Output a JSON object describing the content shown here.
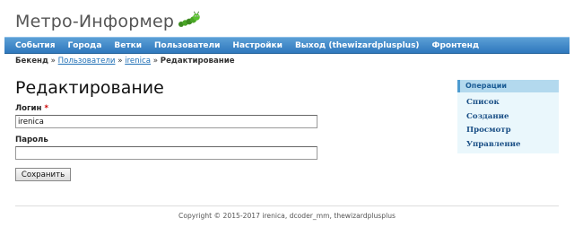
{
  "header": {
    "title": "Метро-Информер",
    "logo_icon": "caterpillar-icon"
  },
  "main_menu": {
    "items": [
      {
        "label": "События"
      },
      {
        "label": "Города"
      },
      {
        "label": "Ветки"
      },
      {
        "label": "Пользователи"
      },
      {
        "label": "Настройки"
      },
      {
        "label": "Выход (thewizardplusplus)"
      },
      {
        "label": "Фронтенд"
      }
    ]
  },
  "breadcrumb": {
    "root": "Бекенд",
    "separator": "»",
    "link1": "Пользователи",
    "link2": "irenica",
    "current": "Редактирование"
  },
  "page": {
    "heading": "Редактирование"
  },
  "form": {
    "login_label": "Логин",
    "required_mark": "*",
    "login_value": "irenica",
    "password_label": "Пароль",
    "password_value": "",
    "submit_label": "Сохранить"
  },
  "sidebar": {
    "title": "Операции",
    "items": [
      {
        "label": "Список"
      },
      {
        "label": "Создание"
      },
      {
        "label": "Просмотр"
      },
      {
        "label": "Управление"
      }
    ]
  },
  "footer": {
    "text": "Copyright © 2015-2017 irenica, dcoder_mm, thewizardplusplus"
  },
  "colors": {
    "menu_bar": "#2f78bd",
    "link": "#1f6fb5",
    "sidebar_bg": "#eaf7fc",
    "sidebar_header": "#b3d9ee"
  }
}
